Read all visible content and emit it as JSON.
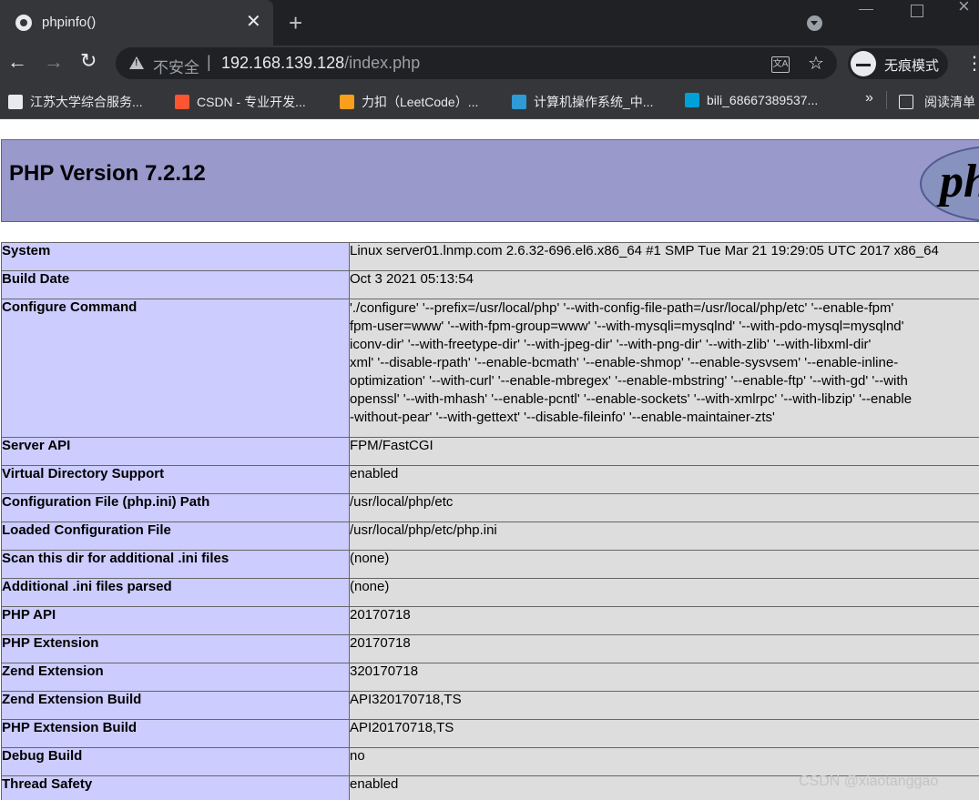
{
  "tab": {
    "title": "phpinfo()"
  },
  "address": {
    "security_label": "不安全",
    "separator": "|",
    "host": "192.168.139.128",
    "path": "/index.php"
  },
  "incognito_label": "无痕模式",
  "bookmarks": [
    {
      "label": "江苏大学综合服务...",
      "icon_color": "#e8eaed"
    },
    {
      "label": "CSDN - 专业开发...",
      "icon_color": "#fc5531"
    },
    {
      "label": "力扣（LeetCode）...",
      "icon_color": "#f89f1b"
    },
    {
      "label": "计算机操作系统_中...",
      "icon_color": "#2e9bd6"
    },
    {
      "label": "bili_68667389537...",
      "icon_color": "#00a1d6"
    }
  ],
  "bookmarks_more": "»",
  "reading_list": "阅读清单",
  "php": {
    "version_title": "PHP Version 7.2.12",
    "logo_text": "php"
  },
  "rows": [
    {
      "key": "System",
      "value": "Linux server01.lnmp.com 2.6.32-696.el6.x86_64 #1 SMP Tue Mar 21 19:29:05 UTC 2017 x86_64"
    },
    {
      "key": "Build Date",
      "value": "Oct 3 2021 05:13:54"
    },
    {
      "key": "Configure Command",
      "lines": [
        "'./configure' '--prefix=/usr/local/php' '--with-config-file-path=/usr/local/php/etc' '--enable-fpm'",
        "fpm-user=www' '--with-fpm-group=www' '--with-mysqli=mysqlnd' '--with-pdo-mysql=mysqlnd'",
        "iconv-dir' '--with-freetype-dir' '--with-jpeg-dir' '--with-png-dir' '--with-zlib' '--with-libxml-dir'",
        "xml' '--disable-rpath' '--enable-bcmath' '--enable-shmop' '--enable-sysvsem' '--enable-inline-",
        "optimization' '--with-curl' '--enable-mbregex' '--enable-mbstring' '--enable-ftp' '--with-gd' '--with",
        "openssl' '--with-mhash' '--enable-pcntl' '--enable-sockets' '--with-xmlrpc' '--with-libzip' '--enable",
        "-without-pear' '--with-gettext' '--disable-fileinfo' '--enable-maintainer-zts'"
      ]
    },
    {
      "key": "Server API",
      "value": "FPM/FastCGI"
    },
    {
      "key": "Virtual Directory Support",
      "value": "enabled"
    },
    {
      "key": "Configuration File (php.ini) Path",
      "value": "/usr/local/php/etc"
    },
    {
      "key": "Loaded Configuration File",
      "value": "/usr/local/php/etc/php.ini"
    },
    {
      "key": "Scan this dir for additional .ini files",
      "value": "(none)"
    },
    {
      "key": "Additional .ini files parsed",
      "value": "(none)"
    },
    {
      "key": "PHP API",
      "value": "20170718"
    },
    {
      "key": "PHP Extension",
      "value": "20170718"
    },
    {
      "key": "Zend Extension",
      "value": "320170718"
    },
    {
      "key": "Zend Extension Build",
      "value": "API320170718,TS"
    },
    {
      "key": "PHP Extension Build",
      "value": "API20170718,TS"
    },
    {
      "key": "Debug Build",
      "value": "no"
    },
    {
      "key": "Thread Safety",
      "value": "enabled"
    }
  ],
  "watermark": "CSDN @xiaotanggao"
}
